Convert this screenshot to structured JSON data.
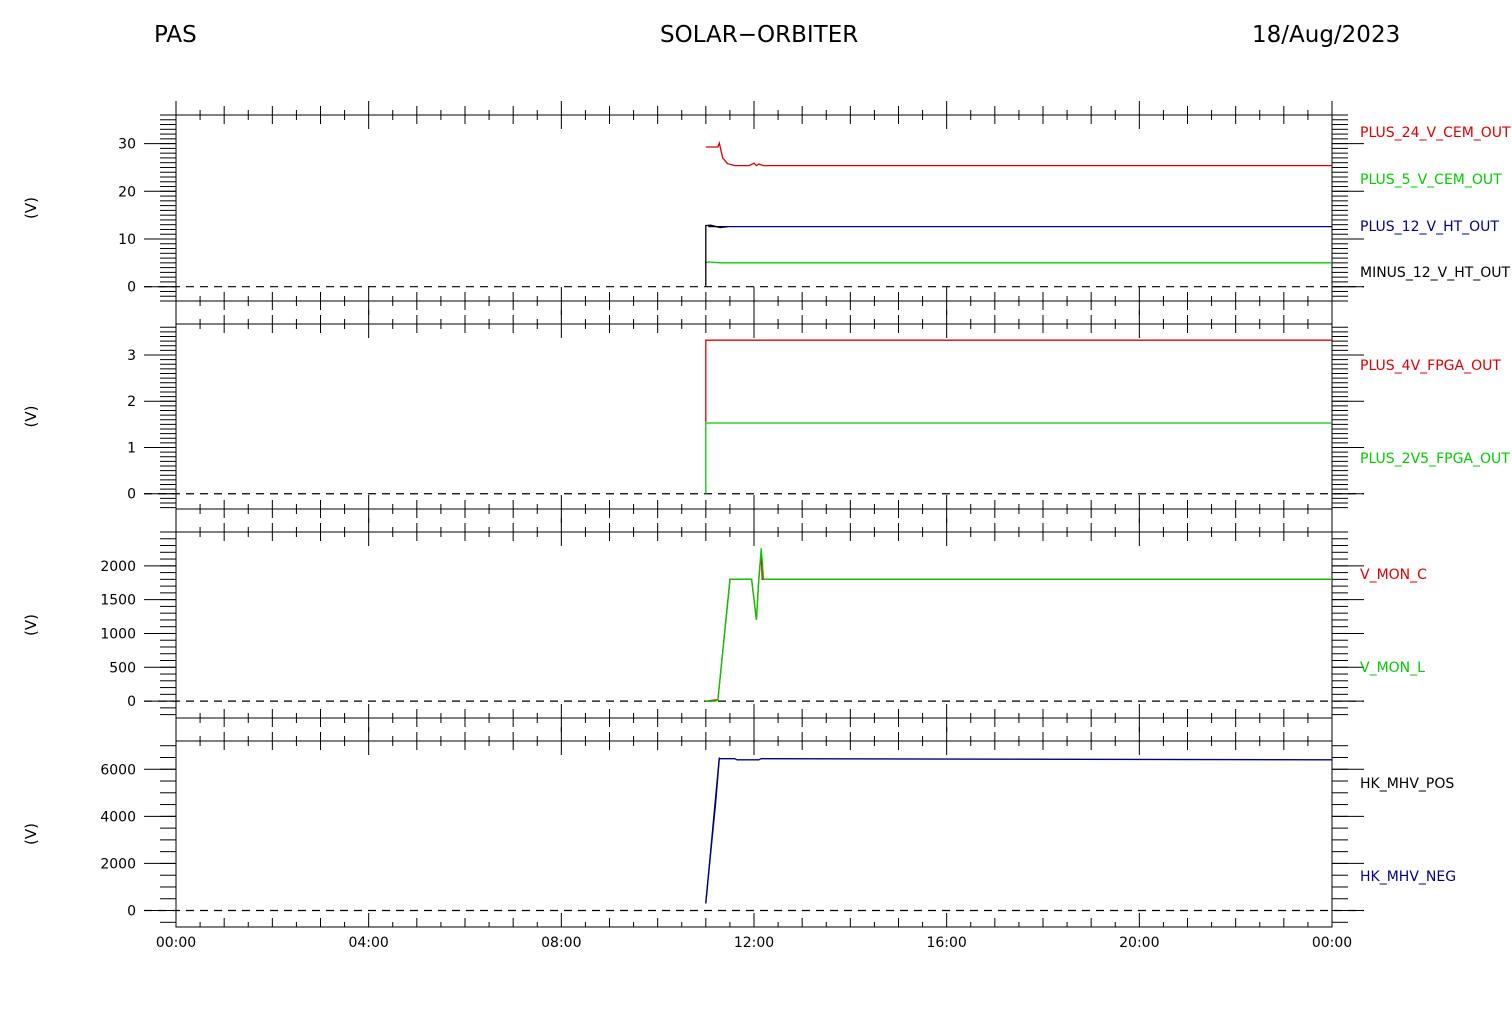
{
  "header": {
    "left": "PAS",
    "center": "SOLAR−ORBITER",
    "right": "18/Aug/2023"
  },
  "chart_data": [
    {
      "type": "line",
      "ylabel": "(V)",
      "ylim": [
        -3,
        36
      ],
      "yticks": [
        0,
        10,
        20,
        30
      ],
      "yminor": 1,
      "xlim": [
        0,
        24
      ],
      "series": [
        {
          "name": "PLUS_24_V_CEM_OUT",
          "color": "#dd0000",
          "x": [
            11.0,
            11.25,
            11.28,
            11.35,
            11.45,
            11.6,
            11.9,
            12.0,
            12.05,
            12.1,
            12.2,
            24.0
          ],
          "y": [
            29.3,
            29.3,
            30.1,
            27.0,
            25.8,
            25.4,
            25.4,
            25.9,
            25.4,
            25.7,
            25.4,
            25.4
          ]
        },
        {
          "name": "PLUS_5_V_CEM_OUT",
          "color": "#00cc00",
          "x": [
            11.0,
            11.05,
            11.3,
            24.0
          ],
          "y": [
            5.0,
            5.2,
            5.0,
            5.0
          ]
        },
        {
          "name": "PLUS_12_V_HT_OUT",
          "color": "#00008b",
          "x": [
            11.05,
            11.4,
            11.5,
            24.0
          ],
          "y": [
            12.6,
            12.6,
            12.6,
            12.6
          ]
        },
        {
          "name": "MINUS_12_V_HT_OUT",
          "color": "#000000",
          "x": [
            11.0,
            11.0,
            11.1,
            11.3,
            11.45
          ],
          "y": [
            0,
            12.8,
            12.9,
            12.4,
            12.6
          ]
        }
      ]
    },
    {
      "type": "line",
      "ylabel": "(V)",
      "ylim": [
        -0.33,
        3.67
      ],
      "yticks": [
        0,
        1,
        2,
        3
      ],
      "yminor": 0.1,
      "xlim": [
        0,
        24
      ],
      "series": [
        {
          "name": "PLUS_4V_FPGA_OUT",
          "color": "#dd0000",
          "x": [
            11.0,
            11.0,
            24.0
          ],
          "y": [
            1.55,
            3.32,
            3.32
          ]
        },
        {
          "name": "PLUS_2V5_FPGA_OUT",
          "color": "#00cc00",
          "x": [
            11.0,
            11.0,
            24.0
          ],
          "y": [
            0.0,
            1.53,
            1.53
          ]
        }
      ]
    },
    {
      "type": "line",
      "ylabel": "(V)",
      "ylim": [
        -250,
        2500
      ],
      "yticks": [
        0,
        500,
        1000,
        1500,
        2000
      ],
      "yminor": 100,
      "xlim": [
        0,
        24
      ],
      "series": [
        {
          "name": "V_MON_C",
          "color": "#dd0000",
          "x": [
            11.0,
            11.25,
            11.5,
            11.5,
            11.95,
            12.05,
            12.1,
            12.15,
            12.17,
            24.0
          ],
          "y": [
            0,
            20,
            1780,
            1800,
            1800,
            1200,
            1800,
            2200,
            1800,
            1800
          ]
        },
        {
          "name": "V_MON_L",
          "color": "#00cc00",
          "x": [
            11.0,
            11.2,
            11.25,
            11.5,
            11.55,
            11.95,
            12.0,
            12.05,
            12.1,
            12.15,
            12.2,
            24.0
          ],
          "y": [
            0,
            0,
            20,
            1800,
            1800,
            1800,
            1500,
            1200,
            1800,
            2260,
            1800,
            1800
          ]
        }
      ]
    },
    {
      "type": "line",
      "ylabel": "(V)",
      "ylim": [
        -700,
        7200
      ],
      "yticks": [
        0,
        2000,
        4000,
        6000
      ],
      "yminor": 500,
      "xlim": [
        0,
        24
      ],
      "xtick_labels": [
        "00:00",
        "04:00",
        "08:00",
        "12:00",
        "16:00",
        "20:00",
        "00:00"
      ],
      "series": [
        {
          "name": "HK_MHV_POS",
          "color": "#000000",
          "x": [
            11.0,
            11.28
          ],
          "y": [
            300,
            6500
          ]
        },
        {
          "name": "HK_MHV_NEG",
          "color": "#00008b",
          "x": [
            11.0,
            11.2,
            11.28,
            11.6,
            11.65,
            12.1,
            12.15,
            24.0
          ],
          "y": [
            350,
            4500,
            6450,
            6450,
            6400,
            6400,
            6450,
            6400
          ]
        }
      ]
    }
  ]
}
